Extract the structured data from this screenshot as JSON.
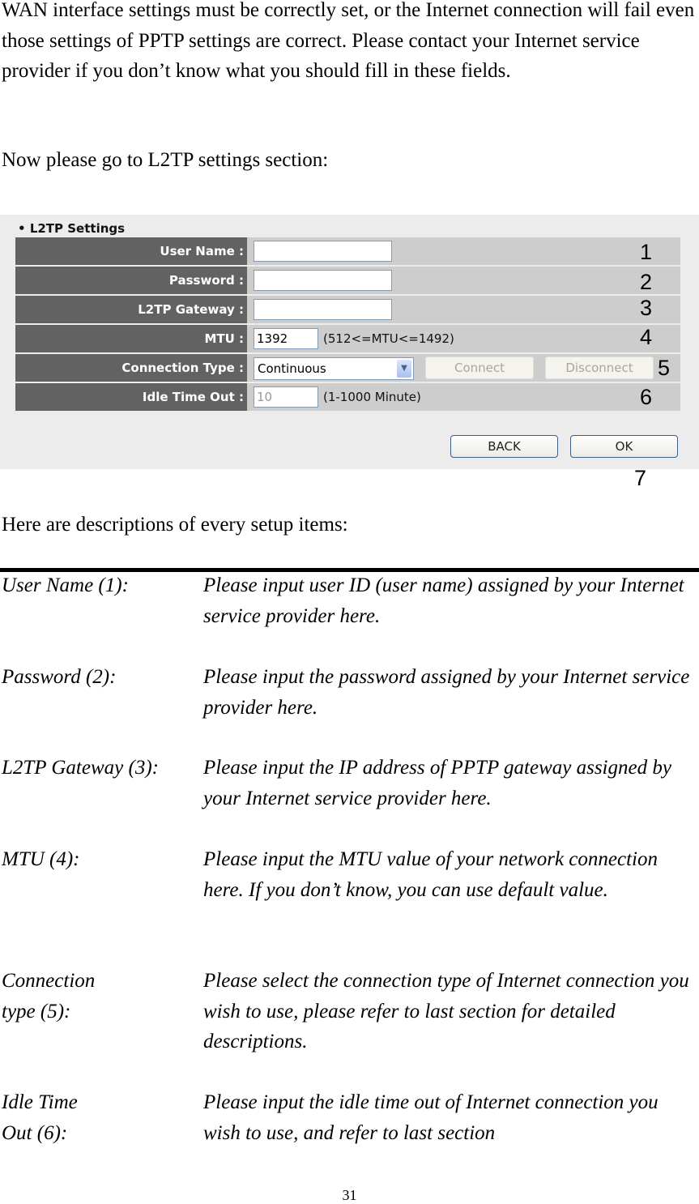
{
  "intro": {
    "paragraph1": "WAN interface settings must be correctly set, or the Internet connection will fail even those settings of PPTP settings are correct. Please contact your Internet service provider if you don’t know what you should fill in these fields.",
    "paragraph2": "Now please go to L2TP settings section:"
  },
  "screenshot": {
    "title": "L2TP Settings",
    "fields": {
      "user_name": {
        "label": "User Name :",
        "value": "",
        "marker": "1"
      },
      "password": {
        "label": "Password :",
        "value": "",
        "marker": "2"
      },
      "gateway": {
        "label": "L2TP Gateway :",
        "value": "",
        "marker": "3"
      },
      "mtu": {
        "label": "MTU :",
        "value": "1392",
        "hint": "(512<=MTU<=1492)",
        "marker": "4"
      },
      "connection_type": {
        "label": "Connection Type :",
        "value": "Continuous",
        "connect": "Connect",
        "disconnect": "Disconnect",
        "marker": "5"
      },
      "idle_time": {
        "label": "Idle Time Out :",
        "value": "10",
        "hint": "(1-1000 Minute)",
        "marker": "6"
      }
    },
    "back": "BACK",
    "ok": "OK",
    "buttons_marker": "7"
  },
  "descriptions_intro": "Here are descriptions of every setup items:",
  "descriptions": [
    {
      "term": "User Name (1):",
      "text": "Please input user ID (user name) assigned by your Internet service provider here."
    },
    {
      "term": "Password (2):",
      "text": "Please input the password assigned by your Internet service provider here."
    },
    {
      "term": "L2TP Gateway (3):",
      "text": "Please input the IP address of PPTP gateway assigned by your Internet service provider here."
    },
    {
      "term": "MTU (4):",
      "text": "Please input the MTU value of your network connection here. If you don’t know, you can use default value."
    },
    {
      "term": "Connection type (5):",
      "text": "Please select the connection type of Internet connection you wish to use, please refer to last section for detailed descriptions."
    },
    {
      "term": "Idle Time Out (6):",
      "text": "Please input the idle time out of Internet connection you wish to use, and refer to last section"
    }
  ],
  "page_number": "31"
}
